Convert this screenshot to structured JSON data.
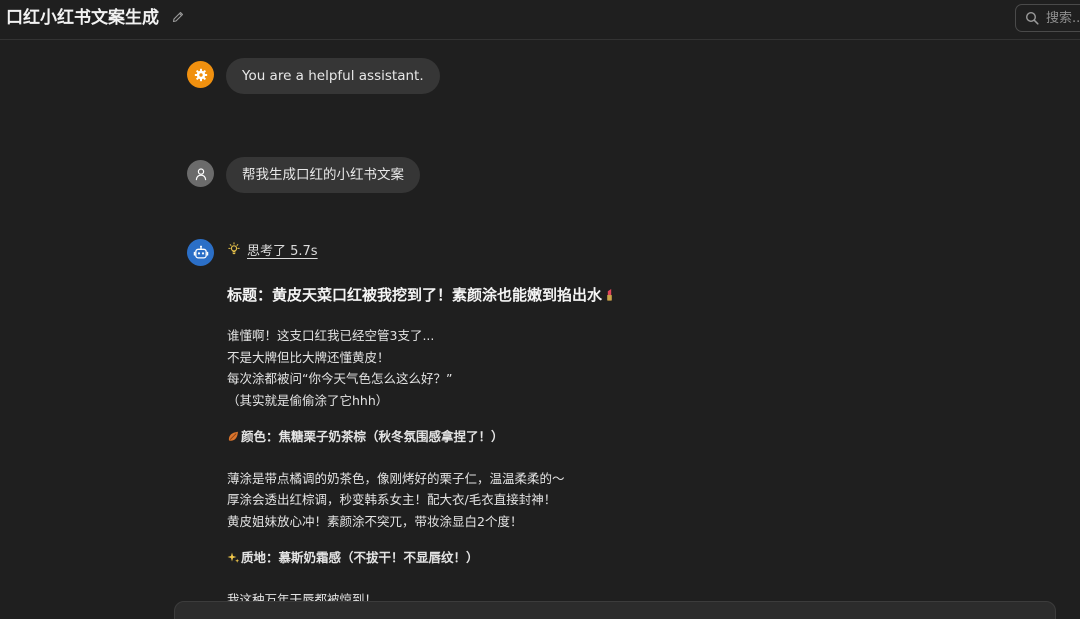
{
  "header": {
    "title": "口红小红书文案生成",
    "search_placeholder": "搜索..."
  },
  "messages": {
    "system": {
      "text": "You are a helpful assistant.",
      "avatar_icon": "gear-icon",
      "avatar_color": "#f0900f"
    },
    "user": {
      "text": "帮我生成口红的小红书文案",
      "avatar_icon": "person-icon",
      "avatar_color": "#6b6b6b"
    },
    "assistant": {
      "avatar_icon": "robot-icon",
      "avatar_color": "#2b6fc7",
      "thinking_label": "思考了 5.7s",
      "title": "标题：黄皮天菜口红被我挖到了！素颜涂也能嫩到掐出水",
      "intro": [
        "谁懂啊！这支口红我已经空管3支了...",
        "不是大牌但比大牌还懂黄皮！",
        "每次涂都被问“你今天气色怎么这么好？”",
        "（其实就是偷偷涂了它hhh）"
      ],
      "color_heading": "颜色：焦糖栗子奶茶棕（秋冬氛围感拿捏了！）",
      "color_lines": [
        "薄涂是带点橘调的奶茶色，像刚烤好的栗子仁，温温柔柔的～",
        "厚涂会透出红棕调，秒变韩系女主！配大衣/毛衣直接封神！",
        "黄皮姐妹放心冲！素颜涂不突兀，带妆涂显白2个度！"
      ],
      "texture_heading": "质地：慕斯奶霜感（不拔干！不显唇纹！）",
      "texture_lines": [
        "我这种万年干唇都被惊到！"
      ]
    }
  }
}
